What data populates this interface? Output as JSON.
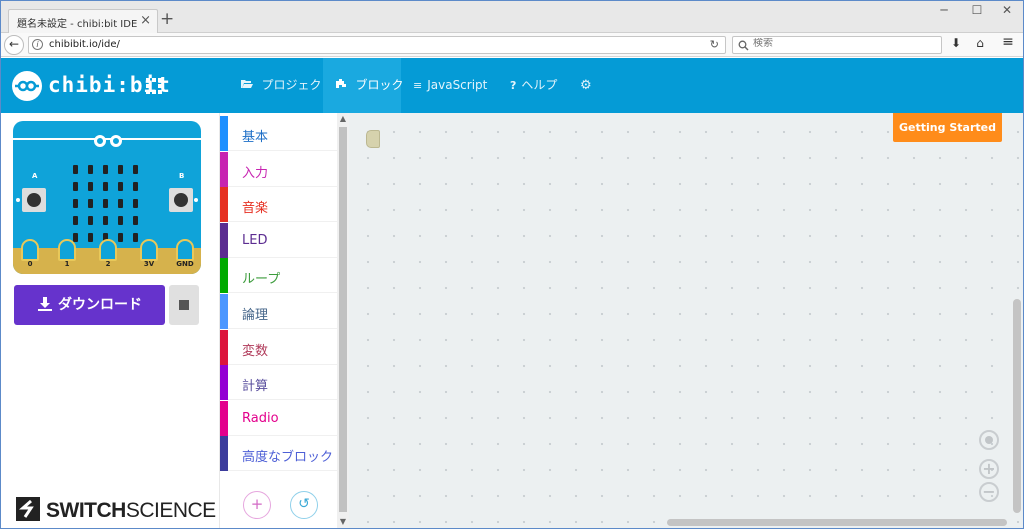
{
  "browser": {
    "tab_title": "題名未設定 - chibi:bit IDE",
    "tab_close": "×",
    "new_tab": "+",
    "window_controls": {
      "minimize": "─",
      "maximize": "☐",
      "close": "✕"
    },
    "back": "←",
    "info": "i",
    "url": "chibibit.io/ide/",
    "reload": "↻",
    "search_icon": "search-icon",
    "search_placeholder": "検索",
    "download_icon": "⬇",
    "home_icon": "⌂",
    "menu_icon": "≡"
  },
  "appbar": {
    "logo_text": "chibi:bit",
    "accent_color": "#059bd6",
    "menu": [
      {
        "icon": "folder-open-icon",
        "glyph": "▭",
        "label": "プロジェクト",
        "active": false
      },
      {
        "icon": "puzzle-icon",
        "glyph": "✚",
        "label": "ブロック",
        "active": true
      },
      {
        "icon": "align-left-icon",
        "glyph": "≡",
        "label": "JavaScript",
        "active": false
      },
      {
        "icon": "help-icon",
        "glyph": "?",
        "label": "ヘルプ",
        "active": false
      },
      {
        "icon": "gear-icon",
        "glyph": "⚙",
        "label": "",
        "active": false
      }
    ]
  },
  "simulator": {
    "button_a": "A",
    "button_b": "B",
    "pins": [
      "0",
      "1",
      "2",
      "3V",
      "GND"
    ],
    "download_label": "ダウンロード",
    "download_color": "#6633cc",
    "stop_icon": "stop-icon"
  },
  "brand": {
    "bold": "SWITCH",
    "light": "SCIENCE"
  },
  "toolbox": {
    "categories": [
      {
        "label": "基本",
        "color": "#1e90ff",
        "text_color": "#1e6fc7"
      },
      {
        "label": "入力",
        "color": "#c724b1",
        "text_color": "#c724b1"
      },
      {
        "label": "音楽",
        "color": "#e63022",
        "text_color": "#e63022"
      },
      {
        "label": "LED",
        "color": "#5c2d91",
        "text_color": "#5c2d91"
      },
      {
        "label": "ループ",
        "color": "#00aa00",
        "text_color": "#3c9c3c"
      },
      {
        "label": "論理",
        "color": "#4c97ff",
        "text_color": "#45668a"
      },
      {
        "label": "変数",
        "color": "#dc143c",
        "text_color": "#b03a5a"
      },
      {
        "label": "計算",
        "color": "#9400d3",
        "text_color": "#5a4f9e"
      },
      {
        "label": "Radio",
        "color": "#e3008c",
        "text_color": "#e3008c"
      },
      {
        "label": "高度なブロック",
        "color": "#3c3c9c",
        "text_color": "#4d5fd6"
      }
    ],
    "add_button": "+",
    "undo_button": "↺",
    "scroll_up": "▲",
    "scroll_down": "▼"
  },
  "workspace": {
    "getting_started": "Getting Started",
    "getting_started_color": "#ff8c1a",
    "zoom_in": "+",
    "zoom_out": "−"
  }
}
